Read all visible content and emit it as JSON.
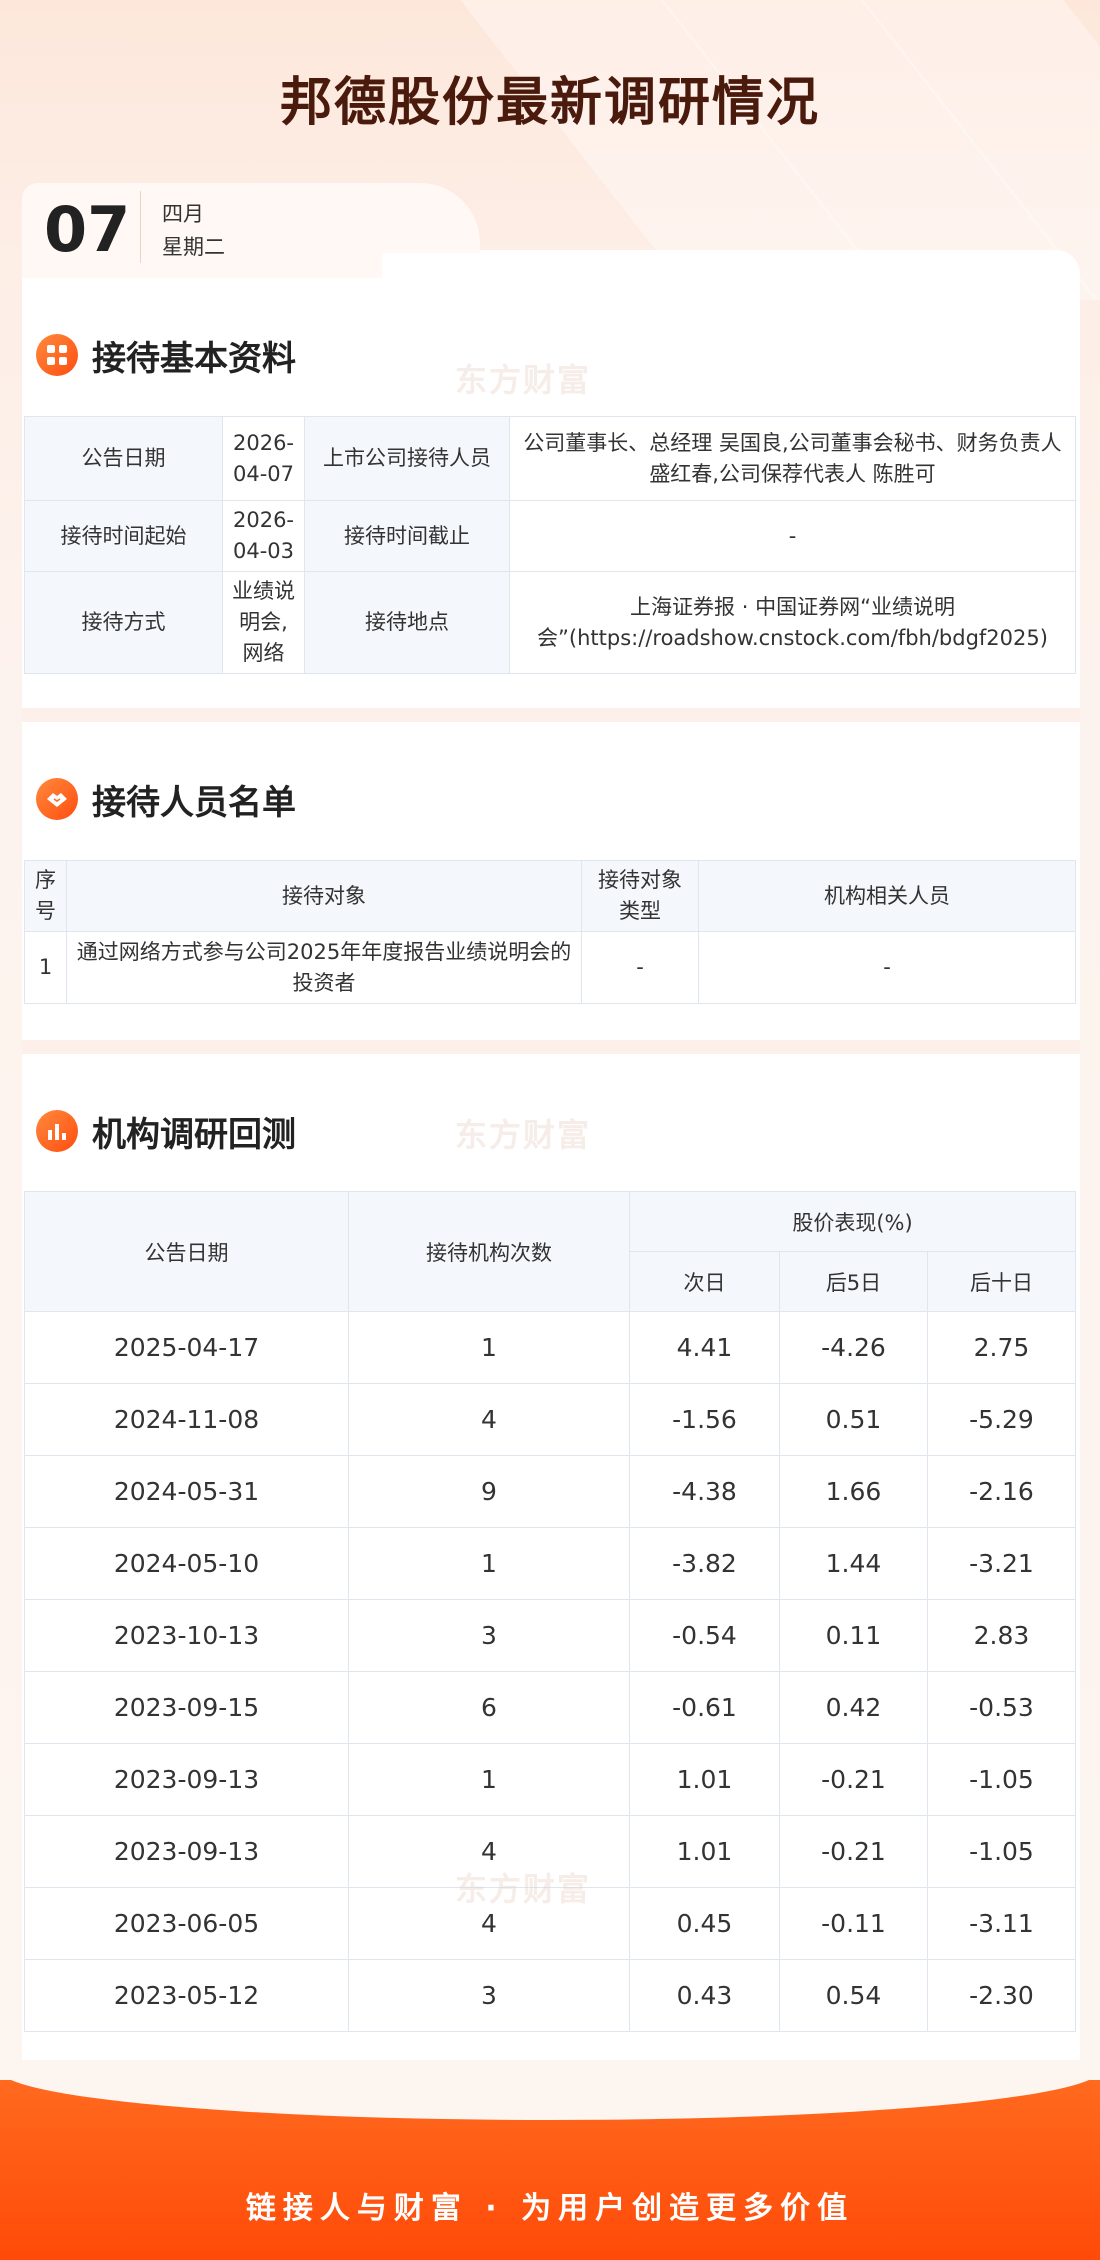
{
  "page_title": "邦德股份最新调研情况",
  "date": {
    "day": "07",
    "month": "四月",
    "weekday": "星期二"
  },
  "watermark": "东方财富",
  "sections": {
    "basic": {
      "title": "接待基本资料"
    },
    "people": {
      "title": "接待人员名单"
    },
    "backtest": {
      "title": "机构调研回测"
    }
  },
  "basic_info": {
    "announce_date_label": "公告日期",
    "announce_date": "2026-04-07",
    "receptionist_label": "上市公司接待人员",
    "receptionist": "公司董事长、总经理 吴国良,公司董事会秘书、财务负责人 盛红春,公司保荐代表人 陈胜可",
    "start_label": "接待时间起始",
    "start": "2026-04-03",
    "end_label": "接待时间截止",
    "end": "-",
    "method_label": "接待方式",
    "method": "业绩说明会,网络",
    "location_label": "接待地点",
    "location": "上海证券报 · 中国证券网“业绩说明会”(https://roadshow.cnstock.com/fbh/bdgf2025)"
  },
  "people_table": {
    "headers": [
      "序号",
      "接待对象",
      "接待对象类型",
      "机构相关人员"
    ],
    "rows": [
      [
        "1",
        "通过网络方式参与公司2025年年度报告业绩说明会的投资者",
        "-",
        "-"
      ]
    ]
  },
  "backtest_table": {
    "headers": {
      "date": "公告日期",
      "count": "接待机构次数",
      "perf": "股价表现(%)",
      "next_day": "次日",
      "day5": "后5日",
      "day10": "后十日"
    },
    "rows": [
      [
        "2025-04-17",
        "1",
        "4.41",
        "-4.26",
        "2.75"
      ],
      [
        "2024-11-08",
        "4",
        "-1.56",
        "0.51",
        "-5.29"
      ],
      [
        "2024-05-31",
        "9",
        "-4.38",
        "1.66",
        "-2.16"
      ],
      [
        "2024-05-10",
        "1",
        "-3.82",
        "1.44",
        "-3.21"
      ],
      [
        "2023-10-13",
        "3",
        "-0.54",
        "0.11",
        "2.83"
      ],
      [
        "2023-09-15",
        "6",
        "-0.61",
        "0.42",
        "-0.53"
      ],
      [
        "2023-09-13",
        "1",
        "1.01",
        "-0.21",
        "-1.05"
      ],
      [
        "2023-09-13",
        "4",
        "1.01",
        "-0.21",
        "-1.05"
      ],
      [
        "2023-06-05",
        "4",
        "0.45",
        "-0.11",
        "-3.11"
      ],
      [
        "2023-05-12",
        "3",
        "0.43",
        "0.54",
        "-2.30"
      ]
    ]
  },
  "footer": {
    "slogan": "链接人与财富 · 为用户创造更多价值"
  },
  "colors": {
    "accent": "#ff5a14",
    "title": "#4a1b0c",
    "label_bg": "#f4f8fc"
  }
}
